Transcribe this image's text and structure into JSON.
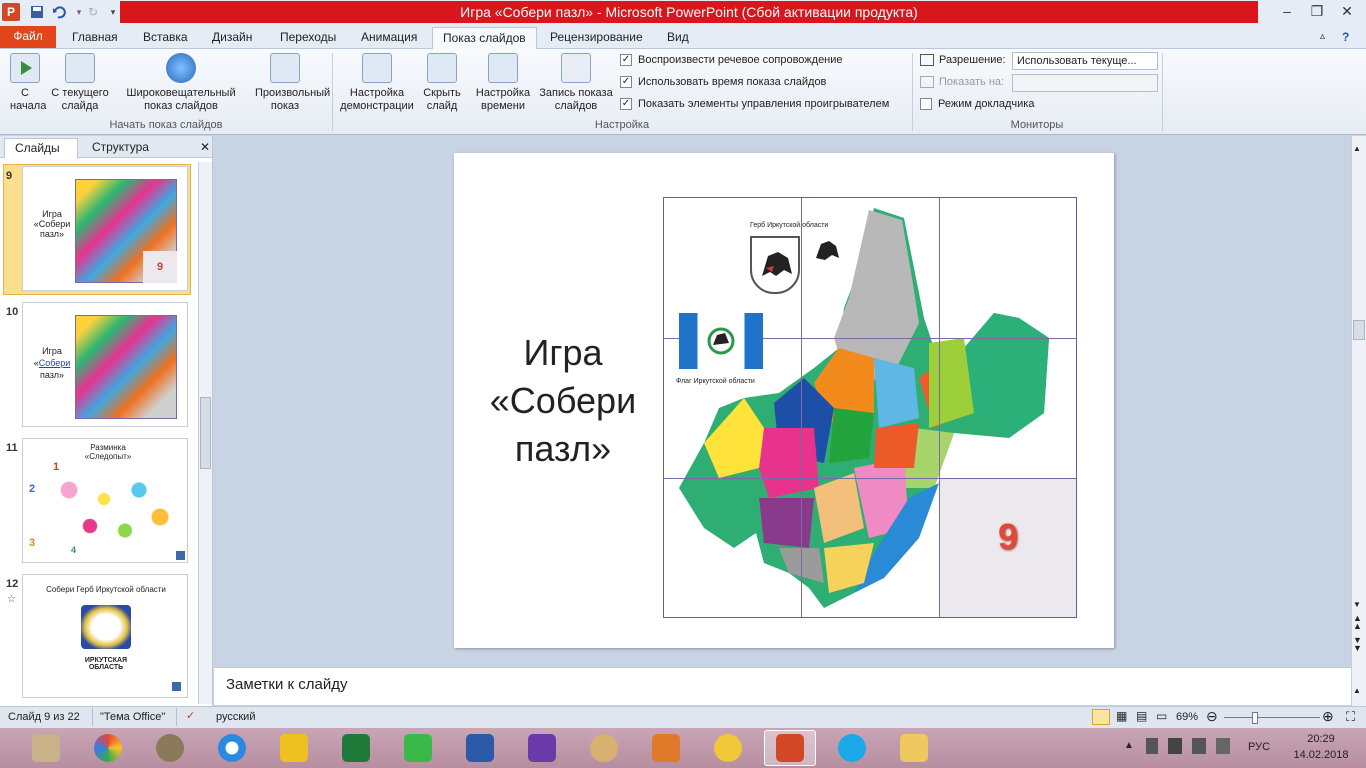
{
  "window": {
    "title": "Игра «Собери пазл»  -  Microsoft PowerPoint (Сбой активации продукта)"
  },
  "tabs": [
    "Файл",
    "Главная",
    "Вставка",
    "Дизайн",
    "Переходы",
    "Анимация",
    "Показ слайдов",
    "Рецензирование",
    "Вид"
  ],
  "ribbon": {
    "btn_start": "С начала",
    "btn_current": "С текущего слайда",
    "btn_broadcast": "Широковещательный показ слайдов",
    "btn_custom": "Произвольный показ",
    "group_start": "Начать показ слайдов",
    "btn_setup": "Настройка демонстрации",
    "btn_hide": "Скрыть слайд",
    "btn_rehearse": "Настройка времени",
    "btn_record": "Запись показа слайдов",
    "chk_narration": "Воспроизвести речевое сопровождение",
    "chk_timings": "Использовать время показа слайдов",
    "chk_controls": "Показать элементы управления проигрывателем",
    "group_setup": "Настройка",
    "resolution_label": "Разрешение:",
    "resolution_value": "Использовать текуще...",
    "showon_label": "Показать на:",
    "presenter_view": "Режим докладчика",
    "group_monitors": "Мониторы"
  },
  "panel": {
    "tab_slides": "Слайды",
    "tab_outline": "Структура"
  },
  "thumbnails": [
    {
      "num": "9",
      "text": "Игра «Собери пазл»",
      "badge": "9"
    },
    {
      "num": "10",
      "text1": "Игра «",
      "link": "Собери",
      "text2": "пазл»"
    },
    {
      "num": "11",
      "title": "Разминка «Следопыт»",
      "n1": "1",
      "n2": "2",
      "n3": "3",
      "n4": "4"
    },
    {
      "num": "12",
      "title": "Собери Герб Иркутской области",
      "caption": "ИРКУТСКАЯ ОБЛАСТЬ"
    }
  ],
  "slide": {
    "title_line1": "Игра",
    "title_line2": "«Собери",
    "title_line3": "пазл»",
    "coat_caption": "Герб Иркутской области",
    "flag_caption": "Флаг Иркутской области",
    "puzzle_number": "9"
  },
  "notes": {
    "placeholder": "Заметки к слайду"
  },
  "status": {
    "slide_info": "Слайд 9 из 22",
    "theme": "\"Тема Office\"",
    "language": "русский",
    "zoom": "69%"
  },
  "tray": {
    "lang": "РУС",
    "time": "20:29",
    "date": "14.02.2018"
  }
}
